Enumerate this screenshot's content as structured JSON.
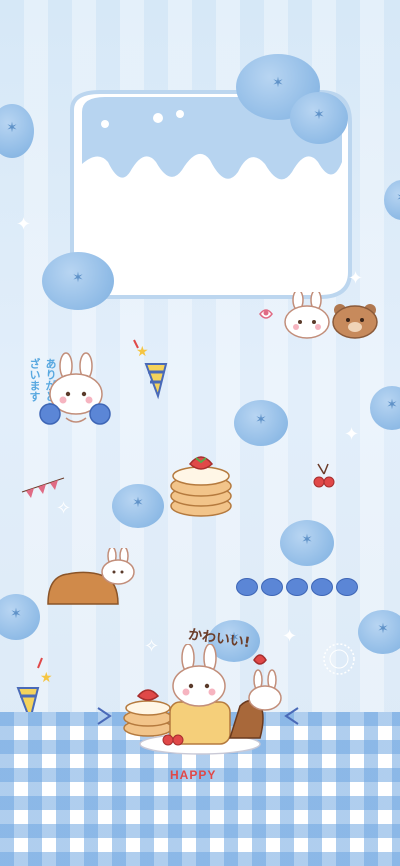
{
  "wallpaper": {
    "colors": {
      "sky": "#d6e8f7",
      "blueberry": "#8fbbe6",
      "gingham": "#6ea5e1",
      "cream": "#ffffff",
      "bunny": "#ffffff",
      "bear": "#b07850",
      "happy_text": "#e04848"
    },
    "decor_text": {
      "happy": "HAPPY",
      "kawaii": "かわいい!",
      "arigatou": "ありがとうございます"
    }
  }
}
